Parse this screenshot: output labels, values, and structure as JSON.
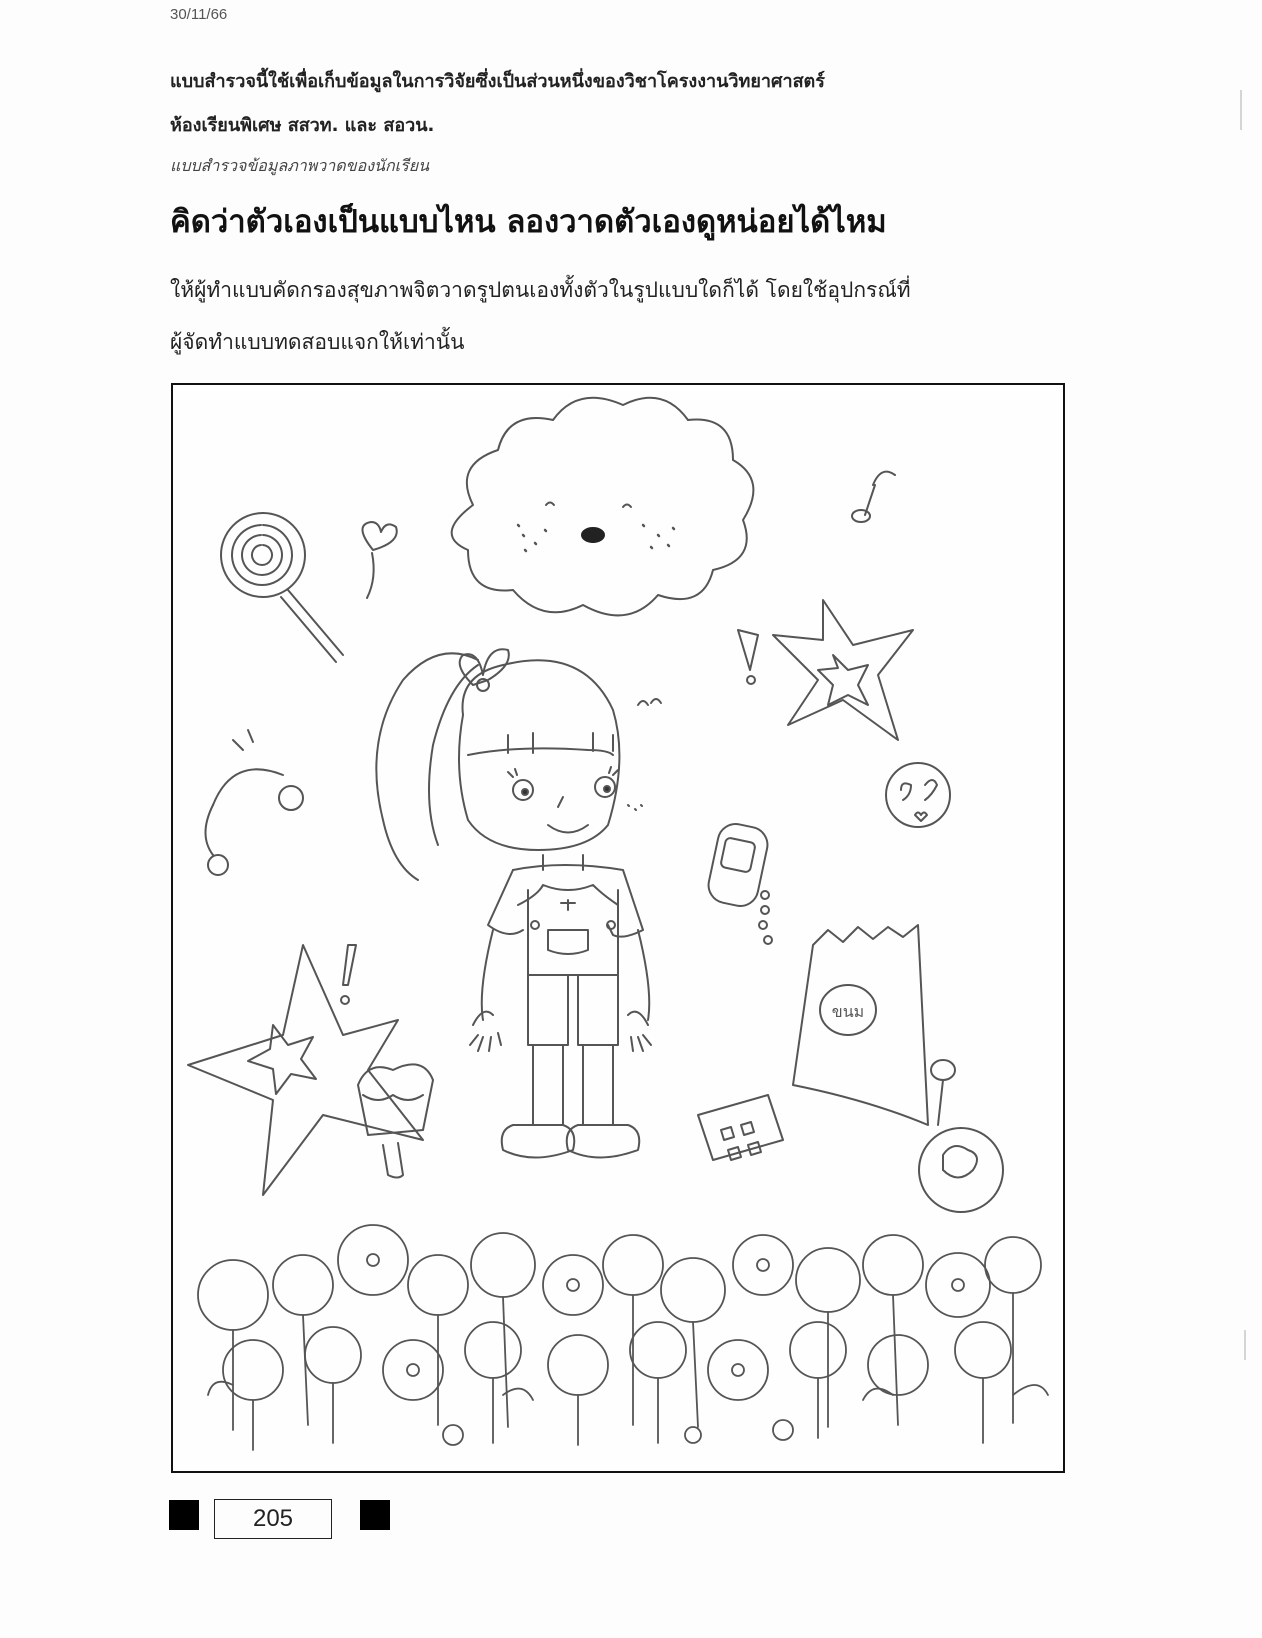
{
  "header": {
    "date": "30/11/66"
  },
  "intro": {
    "line1": "แบบสำรวจนี้ใช้เพื่อเก็บข้อมูลในการวิจัยซึ่งเป็นส่วนหนึ่งของวิชาโครงงานวิทยาศาสตร์",
    "line2": "ห้องเรียนพิเศษ สสวท. และ สอวน."
  },
  "subtitle": "แบบสำรวจข้อมูลภาพวาดของนักเรียน",
  "heading": "คิดว่าตัวเองเป็นแบบไหน ลองวาดตัวเองดูหน่อยได้ไหม",
  "instructions": {
    "line1": "ให้ผู้ทำแบบคัดกรองสุขภาพจิตวาดรูปตนเองทั้งตัวในรูปแบบใดก็ได้ โดยใช้อุปกรณ์ที่",
    "line2": "ผู้จัดทำแบบทดสอบแจกให้เท่านั้น"
  },
  "drawing": {
    "snack_bag_label": "ขนม"
  },
  "footer": {
    "id_number": "205"
  }
}
